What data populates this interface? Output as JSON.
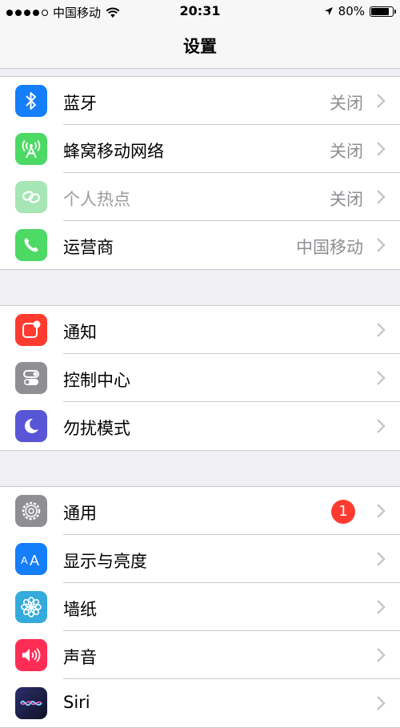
{
  "status_bar": {
    "carrier": "中国移动",
    "time": "20:31",
    "battery_text": "80%",
    "battery_level": 0.8
  },
  "nav": {
    "title": "设置"
  },
  "groups": [
    {
      "rows": [
        {
          "label": "蓝牙",
          "value": "关闭",
          "icon": "bluetooth-icon",
          "color": "#147efb"
        },
        {
          "label": "蜂窝移动网络",
          "value": "关闭",
          "icon": "cellular-antenna-icon",
          "color": "#4cd964"
        },
        {
          "label": "个人热点",
          "value": "关闭",
          "icon": "hotspot-chain-icon",
          "color": "#a5e6b4"
        },
        {
          "label": "运营商",
          "value": "中国移动",
          "icon": "phone-icon",
          "color": "#4cd964"
        }
      ]
    },
    {
      "rows": [
        {
          "label": "通知",
          "value": "",
          "icon": "notifications-icon",
          "color": "#ff3b30"
        },
        {
          "label": "控制中心",
          "value": "",
          "icon": "control-center-icon",
          "color": "#8e8e93"
        },
        {
          "label": "勿扰模式",
          "value": "",
          "icon": "moon-icon",
          "color": "#5856d6"
        }
      ]
    },
    {
      "rows": [
        {
          "label": "通用",
          "badge": "1",
          "icon": "gear-icon",
          "color": "#8e8e93"
        },
        {
          "label": "显示与亮度",
          "value": "",
          "icon": "text-size-icon",
          "color": "#147efb"
        },
        {
          "label": "墙纸",
          "value": "",
          "icon": "flower-icon",
          "color": "#35aadc"
        },
        {
          "label": "声音",
          "value": "",
          "icon": "speaker-icon",
          "color": "#ff2d55"
        },
        {
          "label": "Siri",
          "value": "",
          "icon": "siri-icon",
          "color": "#1b1f3a"
        }
      ]
    }
  ]
}
